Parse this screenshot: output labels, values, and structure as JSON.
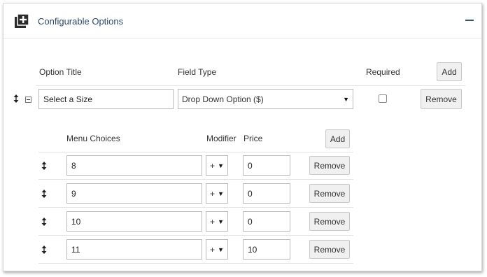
{
  "panel": {
    "title": "Configurable Options",
    "icon": "add-square-icon",
    "collapse_icon": "minus-icon"
  },
  "option_header": {
    "option_title": "Option Title",
    "field_type": "Field Type",
    "required": "Required",
    "add_label": "Add"
  },
  "option": {
    "title_value": "Select a Size",
    "field_type_value": "Drop Down Option ($)",
    "required_checked": false,
    "remove_label": "Remove"
  },
  "choices_header": {
    "menu_choices": "Menu Choices",
    "modifier": "Modifier",
    "price": "Price",
    "add_label": "Add"
  },
  "choices": [
    {
      "value": "8",
      "modifier": "+",
      "price": "0",
      "remove_label": "Remove"
    },
    {
      "value": "9",
      "modifier": "+",
      "price": "0",
      "remove_label": "Remove"
    },
    {
      "value": "10",
      "modifier": "+",
      "price": "0",
      "remove_label": "Remove"
    },
    {
      "value": "11",
      "modifier": "+",
      "price": "10",
      "remove_label": "Remove"
    }
  ],
  "colors": {
    "title": "#2a4a6e",
    "button_bg": "#f0f0f0",
    "border": "#b9b9b9"
  }
}
